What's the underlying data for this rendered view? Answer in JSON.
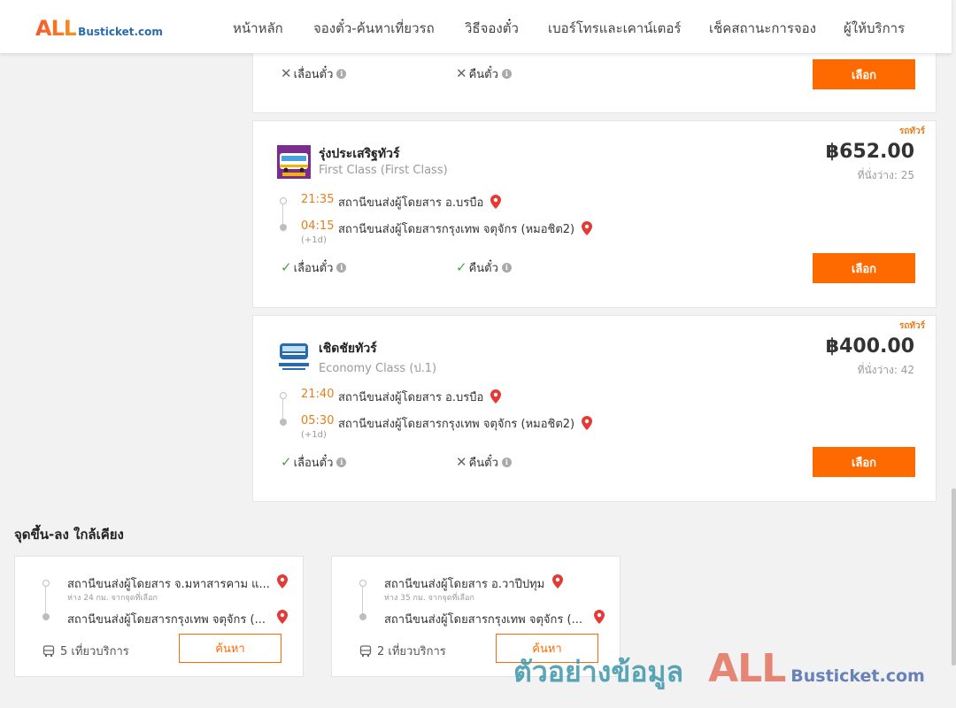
{
  "header": {
    "logo_all": "ALL",
    "logo_rest": "Busticket.com",
    "nav": [
      "หน้าหลัก",
      "จองตั๋ว-ค้นหาเที่ยวรถ",
      "วิธีจองตั๋ว",
      "เบอร์โทรและเคาน์เตอร์",
      "เช็คสถานะการจอง",
      "ผู้ให้บริการ"
    ]
  },
  "top_card": {
    "reschedule_label": "เลื่อนตั๋ว",
    "refund_label": "คืนตั๋ว",
    "select_label": "เลือก"
  },
  "trips": [
    {
      "tag": "รถทัวร์",
      "operator": "รุ่งประเสริฐทัวร์",
      "class": "First Class (First Class)",
      "price": "฿652.00",
      "seats": "ที่นั่งว่าง: 25",
      "depart_time": "21:35",
      "depart_station": "สถานีขนส่งผู้โดยสาร อ.บรบือ",
      "arrive_time": "04:15",
      "arrive_station": "สถานีขนส่งผู้โดยสารกรุงเทพ จตุจักร (หมอชิต2)",
      "next_day": "(+1d)",
      "reschedule_label": "เลื่อนตั๋ว",
      "reschedule_allowed": true,
      "refund_label": "คืนตั๋ว",
      "refund_allowed": true,
      "select_label": "เลือก",
      "logo_color": "#7a2c8f"
    },
    {
      "tag": "รถทัวร์",
      "operator": "เชิดชัยทัวร์",
      "class": "Economy Class (ป.1)",
      "price": "฿400.00",
      "seats": "ที่นั่งว่าง: 42",
      "depart_time": "21:40",
      "depart_station": "สถานีขนส่งผู้โดยสาร อ.บรบือ",
      "arrive_time": "05:30",
      "arrive_station": "สถานีขนส่งผู้โดยสารกรุงเทพ จตุจักร (หมอชิต2)",
      "next_day": "(+1d)",
      "reschedule_label": "เลื่อนตั๋ว",
      "reschedule_allowed": true,
      "refund_label": "คืนตั๋ว",
      "refund_allowed": false,
      "select_label": "เลือก",
      "logo_color": "#2a6bb0"
    }
  ],
  "nearby": {
    "title": "จุดขึ้น-ลง ใกล้เคียง",
    "items": [
      {
        "from": "สถานีขนส่งผู้โดยสาร จ.มหาสารคาม แ...",
        "distance": "ห่าง 24 กม. จากจุดที่เลือก",
        "to": "สถานีขนส่งผู้โดยสารกรุงเทพ จตุจักร (...",
        "trips": "5 เที่ยวบริการ",
        "search_label": "ค้นหา"
      },
      {
        "from": "สถานีขนส่งผู้โดยสาร อ.วาปีปทุม",
        "distance": "ห่าง 35 กม. จากจุดที่เลือก",
        "to": "สถานีขนส่งผู้โดยสารกรุงเทพ จตุจักร (...",
        "trips": "2 เที่ยวบริการ",
        "search_label": "ค้นหา"
      }
    ]
  },
  "watermark": {
    "text": "ตัวอย่างข้อมูล",
    "all": "ALL",
    "rest": "Busticket.com"
  },
  "colors": {
    "accent": "#ff6a00",
    "time": "#e77e1a",
    "check": "#46a546",
    "pin": "#e53935"
  }
}
